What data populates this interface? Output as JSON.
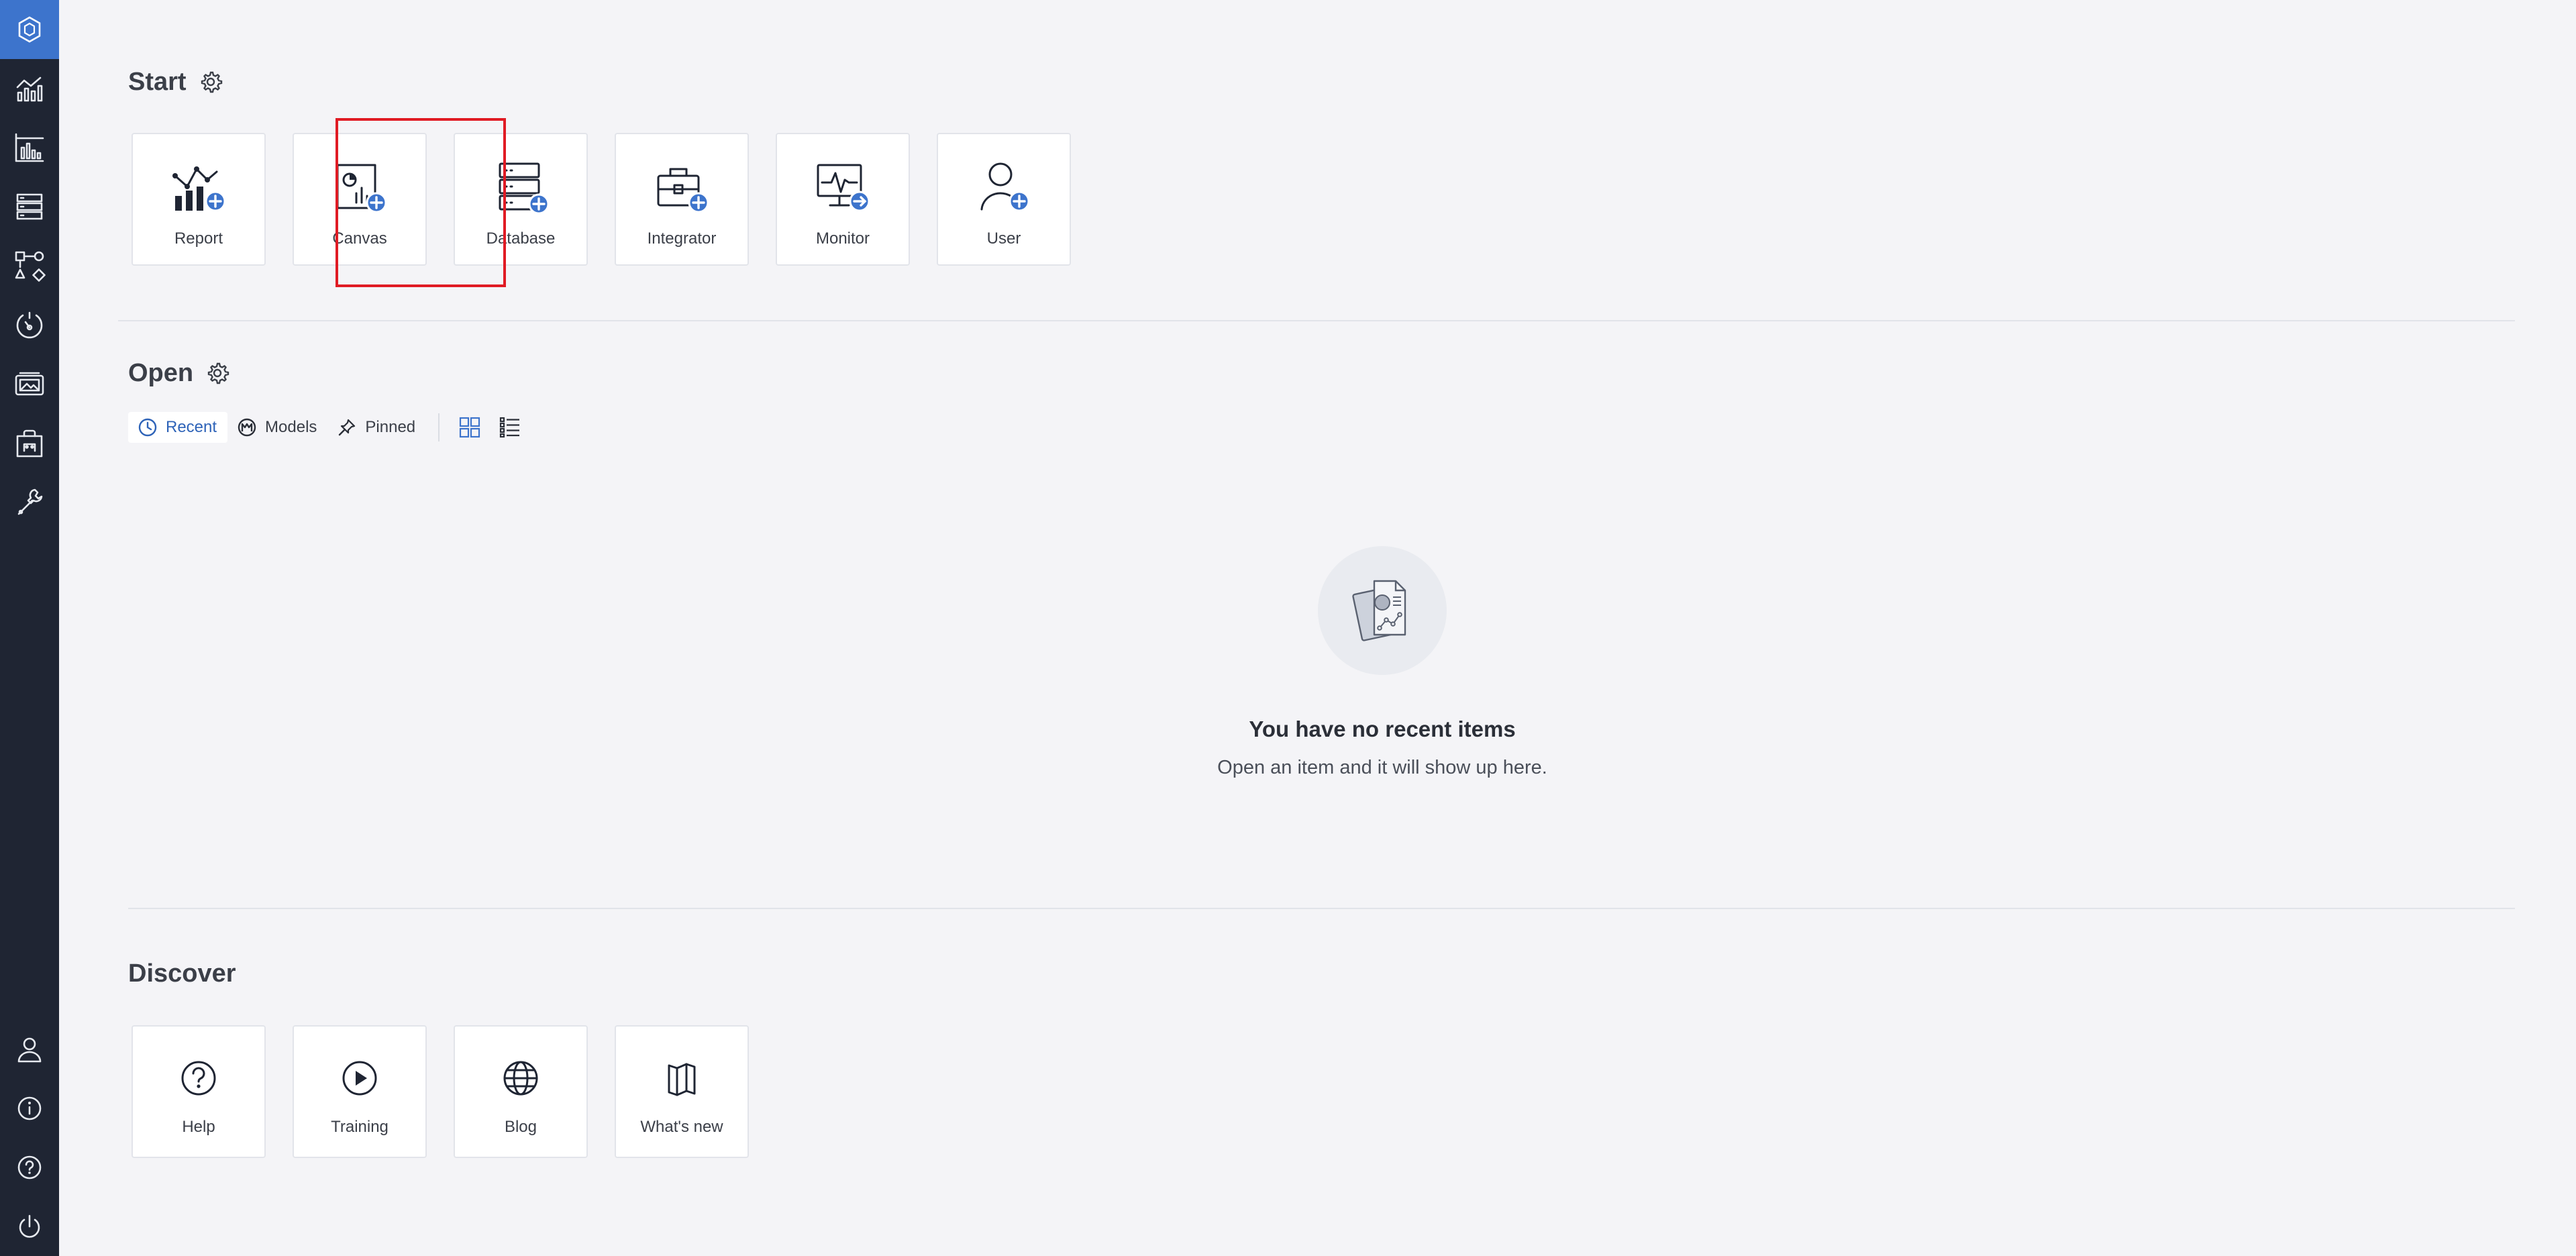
{
  "start": {
    "title": "Start",
    "tiles": [
      {
        "label": "Report",
        "icon": "report-add-icon"
      },
      {
        "label": "Canvas",
        "icon": "canvas-add-icon"
      },
      {
        "label": "Database",
        "icon": "database-add-icon"
      },
      {
        "label": "Integrator",
        "icon": "integrator-add-icon"
      },
      {
        "label": "Monitor",
        "icon": "monitor-add-icon"
      },
      {
        "label": "User",
        "icon": "user-add-icon"
      }
    ]
  },
  "open": {
    "title": "Open",
    "tabs": [
      {
        "label": "Recent",
        "icon": "clock-icon",
        "active": true
      },
      {
        "label": "Models",
        "icon": "models-icon",
        "active": false
      },
      {
        "label": "Pinned",
        "icon": "pin-icon",
        "active": false
      }
    ],
    "views": [
      "grid-view-icon",
      "list-view-icon"
    ],
    "empty": {
      "title": "You have no recent items",
      "subtitle": "Open an item and it will show up here."
    }
  },
  "discover": {
    "title": "Discover",
    "tiles": [
      {
        "label": "Help",
        "icon": "question-icon"
      },
      {
        "label": "Training",
        "icon": "play-icon"
      },
      {
        "label": "Blog",
        "icon": "globe-icon"
      },
      {
        "label": "What's new",
        "icon": "book-icon"
      }
    ]
  },
  "sidebar": {
    "top": [
      "hexagon-logo-icon",
      "analytics-icon",
      "dashboard-icon",
      "database-icon",
      "shapes-icon",
      "monitor-gauge-icon",
      "gallery-icon",
      "store-icon",
      "tools-icon"
    ],
    "bottom": [
      "user-icon",
      "info-icon",
      "help-icon",
      "power-icon"
    ]
  },
  "colors": {
    "accent": "#3d74cc",
    "sidebar": "#1f2533",
    "background": "#f4f4f7",
    "highlight": "#e01b24"
  }
}
